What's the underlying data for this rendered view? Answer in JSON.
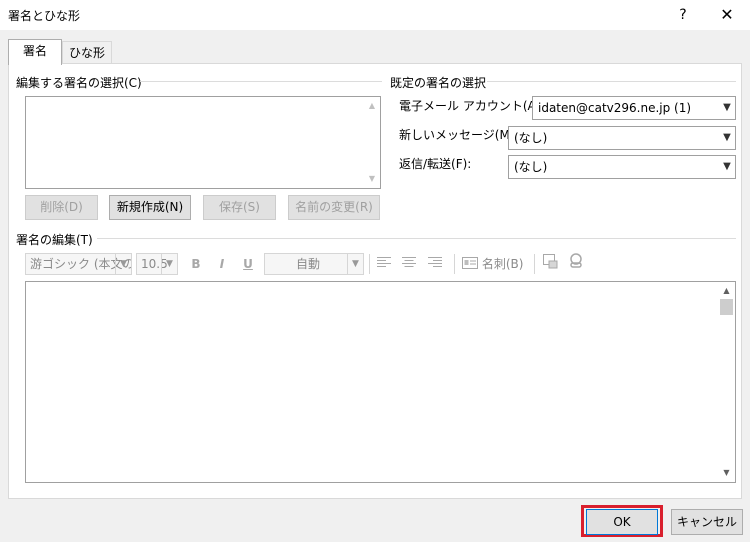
{
  "window": {
    "title": "署名とひな形",
    "help_label": "?",
    "close_label": "✕"
  },
  "tabs": [
    {
      "label": "署名",
      "active": true
    },
    {
      "label": "ひな形",
      "active": false
    }
  ],
  "signature_select": {
    "label": "編集する署名の選択(C)",
    "items": [],
    "buttons": {
      "delete": "削除(D)",
      "new": "新規作成(N)",
      "save": "保存(S)",
      "rename": "名前の変更(R)"
    }
  },
  "default_signature": {
    "label": "既定の署名の選択",
    "email_account_label": "電子メール アカウント(A):",
    "email_account_value": "idaten@catv296.ne.jp (1)",
    "new_message_label": "新しいメッセージ(M):",
    "new_message_value": "(なし)",
    "reply_forward_label": "返信/転送(F):",
    "reply_forward_value": "(なし)"
  },
  "edit_signature": {
    "label": "署名の編集(T)",
    "font_value": "游ゴシック (本文の",
    "size_value": "10.5",
    "bold_label": "B",
    "italic_label": "I",
    "underline_label": "U",
    "color_value": "自動",
    "business_card_label": "名刺(B)",
    "content": ""
  },
  "footer": {
    "ok_label": "OK",
    "cancel_label": "キャンセル"
  },
  "colors": {
    "highlight": "#d9202e"
  }
}
